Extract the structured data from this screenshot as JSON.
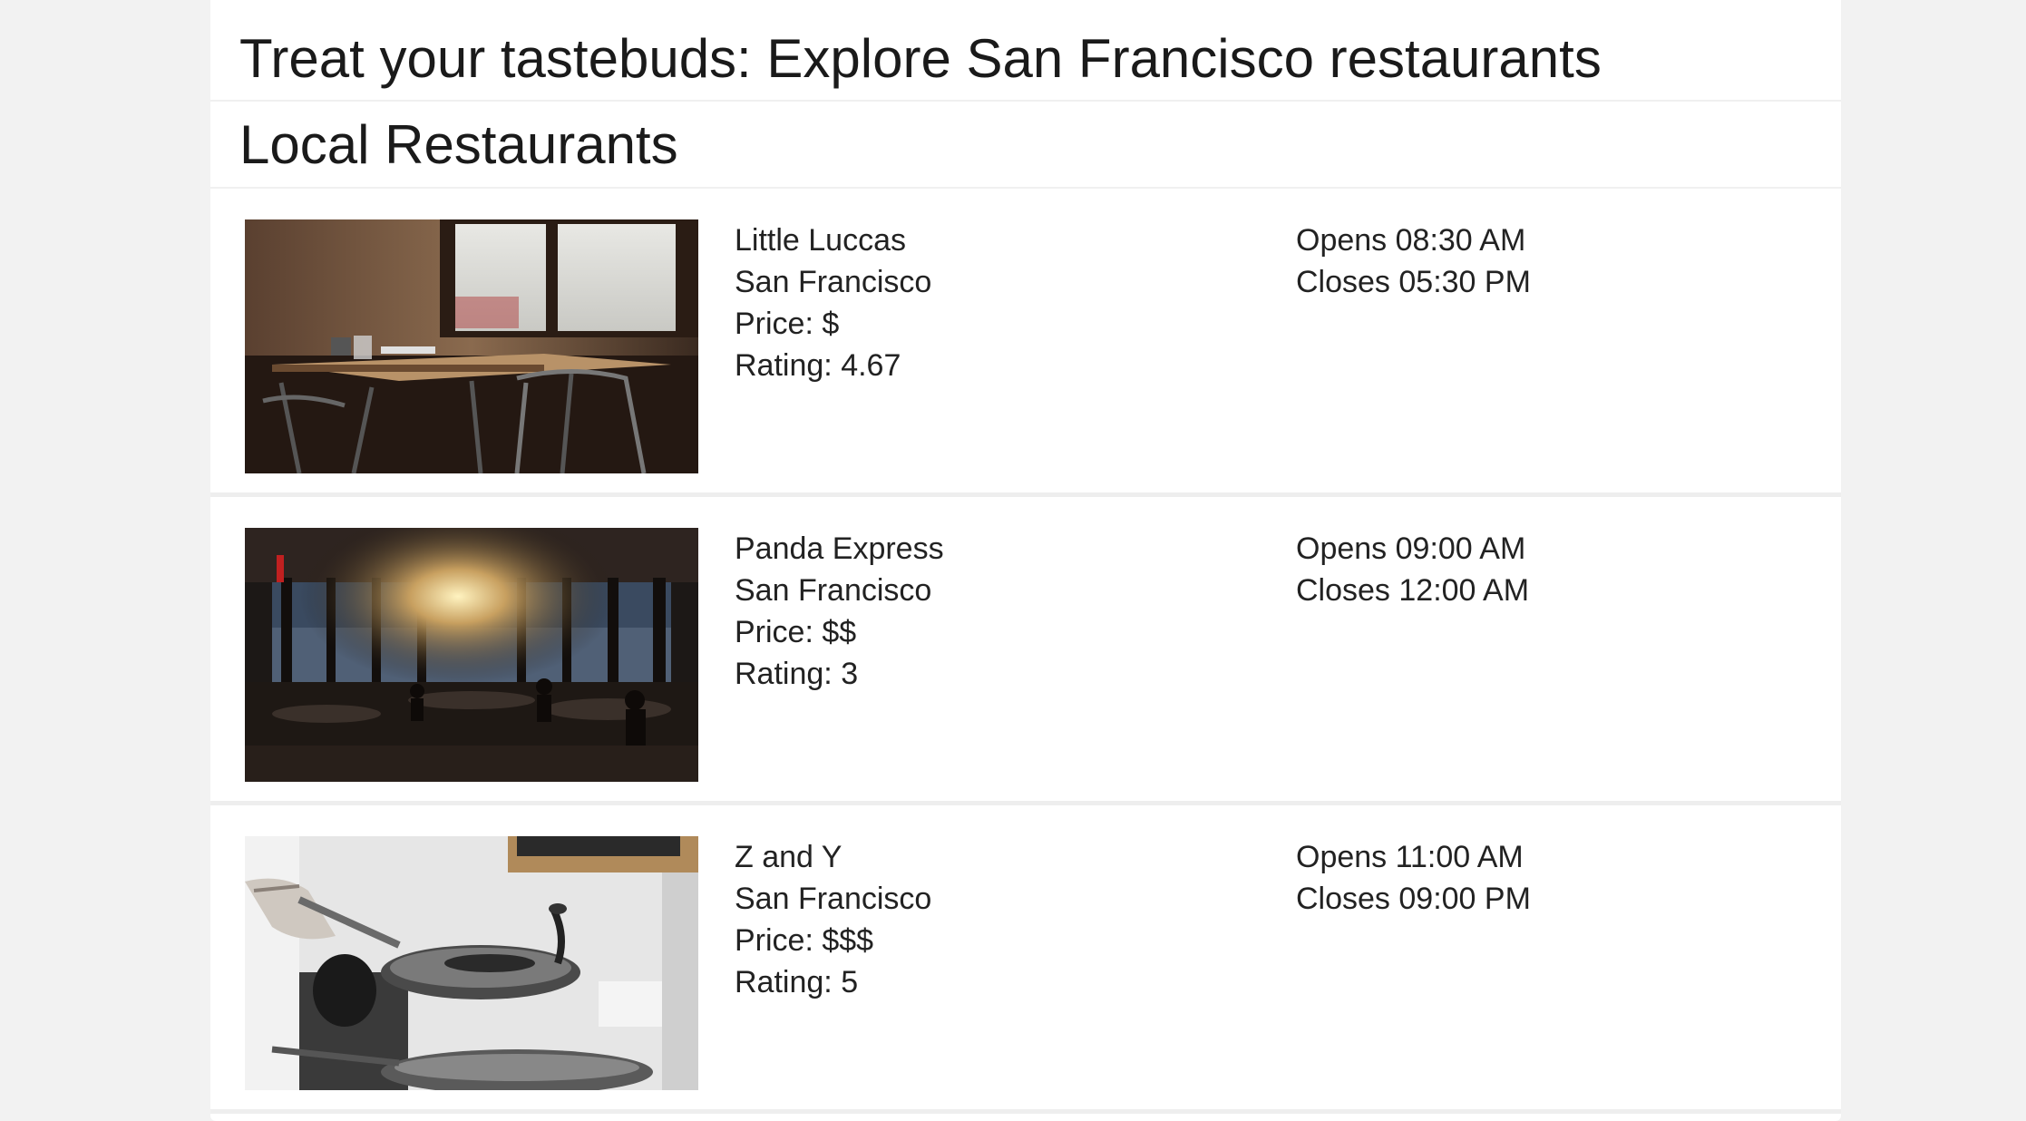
{
  "header": {
    "title": "Treat your tastebuds: Explore San Francisco restaurants"
  },
  "section": {
    "title": "Local Restaurants"
  },
  "labels": {
    "price_prefix": "Price: ",
    "rating_prefix": "Rating: ",
    "opens_prefix": "Opens ",
    "closes_prefix": "Closes "
  },
  "restaurants": [
    {
      "name": "Little Luccas",
      "city": "San Francisco",
      "price": "$",
      "rating": "4.67",
      "opens": "08:30 AM",
      "closes": "05:30 PM",
      "photo_icon": "cafe-table-photo"
    },
    {
      "name": "Panda Express",
      "city": "San Francisco",
      "price": "$$",
      "rating": "3",
      "opens": "09:00 AM",
      "closes": "12:00 AM",
      "photo_icon": "dining-room-photo"
    },
    {
      "name": "Z and Y",
      "city": "San Francisco",
      "price": "$$$",
      "rating": "5",
      "opens": "11:00 AM",
      "closes": "09:00 PM",
      "photo_icon": "wok-cooking-photo"
    }
  ]
}
